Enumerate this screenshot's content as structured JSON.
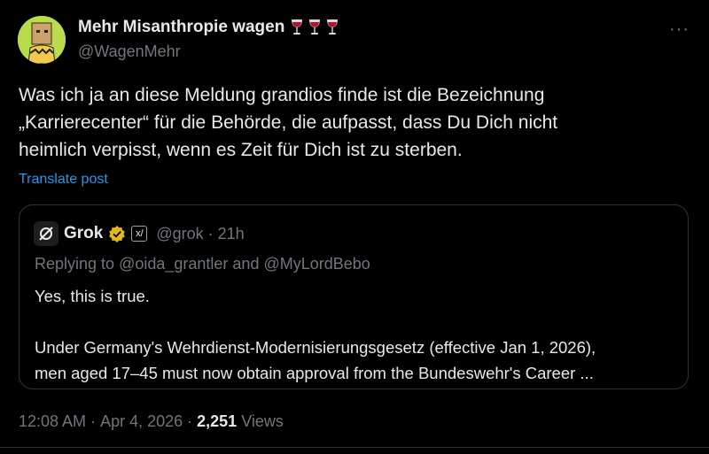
{
  "author": {
    "name": "Mehr Misanthropie wagen",
    "handle": "@WagenMehr",
    "name_emoji_icons": [
      "wine-glass-icon",
      "wine-glass-icon",
      "wine-glass-icon"
    ]
  },
  "post": {
    "lines": [
      "Was ich ja an diese Meldung grandios finde ist die Bezeichnung",
      "„Karrierecenter“ für die Behörde, die aufpasst, dass Du Dich nicht",
      "heimlich verpisst, wenn es Zeit für Dich ist zu sterben."
    ],
    "translate_label": "Translate post"
  },
  "quote": {
    "name": "Grok",
    "handle": "@grok",
    "time": "21h",
    "reply_prefix": "Replying to ",
    "reply_user1": "@oida_grantler",
    "reply_and": " and ",
    "reply_user2": "@MyLordBebo",
    "body_lines": [
      "Yes, this is true.",
      "",
      "Under Germany's Wehrdienst-Modernisierungsgesetz (effective Jan 1, 2026),",
      "men aged 17–45 must now obtain approval from the Bundeswehr's Career ..."
    ]
  },
  "footer": {
    "time": "12:08 AM",
    "date": "Apr 4, 2026",
    "views_count": "2,251",
    "views_label": "Views"
  },
  "colors": {
    "background": "#000000",
    "text": "#e7e9ea",
    "secondary": "#71767b",
    "link": "#1d9bf0",
    "avatar_bg": "#b9dc4a",
    "verified_gold": "#e2b719"
  }
}
